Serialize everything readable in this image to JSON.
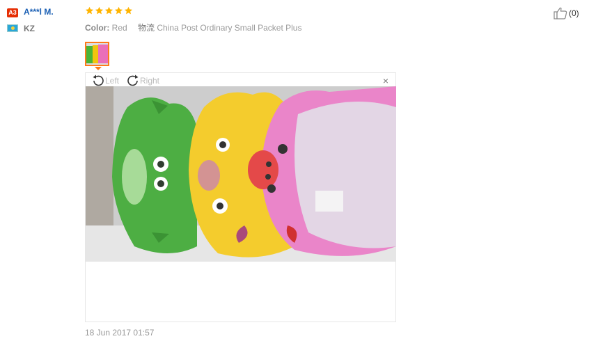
{
  "user": {
    "badge": "A3",
    "name": "A***l M.",
    "country": "KZ"
  },
  "review": {
    "stars": 5,
    "attributes": [
      {
        "key": "Color:",
        "value": "Red"
      },
      {
        "key": "物流",
        "value": "China Post Ordinary Small Packet Plus"
      }
    ],
    "helpful_count": "(0)",
    "date": "18 Jun 2017 01:57"
  },
  "viewer": {
    "rotate_left_label": "Left",
    "rotate_right_label": "Right",
    "close_glyph": "×"
  },
  "colors": {
    "star": "#ffb400",
    "accent": "#ff7a1a",
    "name": "#1a5fb4"
  }
}
